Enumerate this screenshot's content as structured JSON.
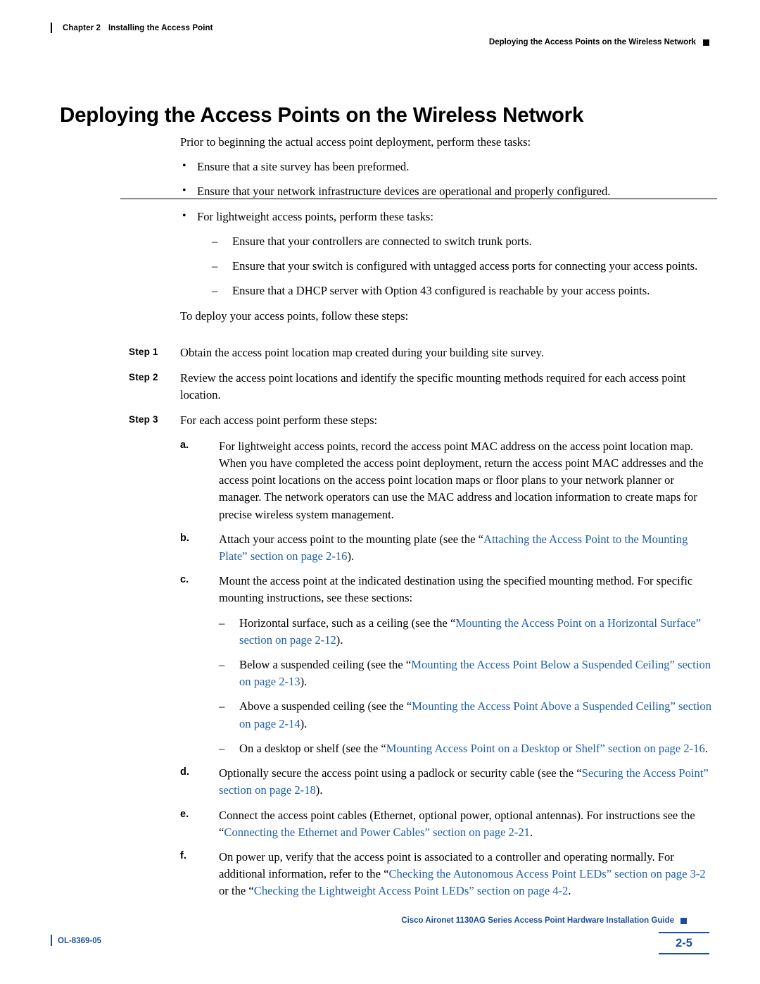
{
  "header": {
    "chapter": "Chapter 2",
    "chapter_title": "Installing the Access Point",
    "running_head": "Deploying the Access Points on the Wireless Network"
  },
  "title": "Deploying the Access Points on the Wireless Network",
  "intro": {
    "lead": "Prior to beginning the actual access point deployment, perform these tasks:",
    "bullets": [
      "Ensure that a site survey has been preformed.",
      "Ensure that your network infrastructure devices are operational and properly configured.",
      "For lightweight access points, perform these tasks:"
    ],
    "dashes": [
      "Ensure that your controllers are connected to switch trunk ports.",
      "Ensure that your switch is configured with untagged access ports for connecting your access points.",
      "Ensure that a DHCP server with Option 43 configured is reachable by your access points."
    ],
    "follow": "To deploy your access points, follow these steps:"
  },
  "steps": [
    {
      "label": "Step 1",
      "text": "Obtain the access point location map created during your building site survey."
    },
    {
      "label": "Step 2",
      "text": "Review the access point locations and identify the specific mounting methods required for each access point location."
    },
    {
      "label": "Step 3",
      "text": "For each access point perform these steps:"
    }
  ],
  "substeps": {
    "a": {
      "label": "a.",
      "text": "For lightweight access points, record the access point MAC address on the access point location map. When you have completed the access point deployment, return the access point MAC addresses and the access point locations on the access point location maps or floor plans to your network planner or manager. The network operators can use the MAC address and location information to create maps for precise wireless system management."
    },
    "b": {
      "label": "b.",
      "text_pre": "Attach your access point to the mounting plate (see the “",
      "link": "Attaching the Access Point to the Mounting Plate” section on page 2-16",
      "text_post": ")."
    },
    "c": {
      "label": "c.",
      "text": "Mount the access point at the indicated destination using the specified mounting method. For specific mounting instructions, see these sections:",
      "dashes": [
        {
          "pre": "Horizontal surface, such as a ceiling (see the “",
          "link": "Mounting the Access Point on a Horizontal Surface” section on page 2-12",
          "post": ")."
        },
        {
          "pre": "Below a suspended ceiling (see the “",
          "link": "Mounting the Access Point Below a Suspended Ceiling” section on page 2-13",
          "post": ")."
        },
        {
          "pre": "Above a suspended ceiling (see the “",
          "link": "Mounting the Access Point Above a Suspended Ceiling” section on page 2-14",
          "post": ")."
        },
        {
          "pre": "On a desktop or shelf (see the “",
          "link": "Mounting Access Point on a Desktop or Shelf” section on page 2-16",
          "post": "."
        }
      ]
    },
    "d": {
      "label": "d.",
      "text_pre": "Optionally secure the access point using a padlock or security cable (see the “",
      "link": "Securing the Access Point” section on page 2-18",
      "text_post": ")."
    },
    "e": {
      "label": "e.",
      "text_pre": "Connect the access point cables (Ethernet, optional power, optional antennas). For instructions see the “",
      "link": "Connecting the Ethernet and Power Cables” section on page 2-21",
      "text_post": "."
    },
    "f": {
      "label": "f.",
      "text_pre": "On power up, verify that the access point is associated to a controller and operating normally. For additional information, refer to the “",
      "link1": "Checking the Autonomous Access Point LEDs” section on page 3-2",
      "mid": " or the “",
      "link2": "Checking the Lightweight Access Point LEDs” section on page 4-2",
      "post": "."
    }
  },
  "footer": {
    "guide": "Cisco Aironet 1130AG Series Access Point Hardware Installation Guide",
    "doc_id": "OL-8369-05",
    "page_number": "2-5"
  }
}
